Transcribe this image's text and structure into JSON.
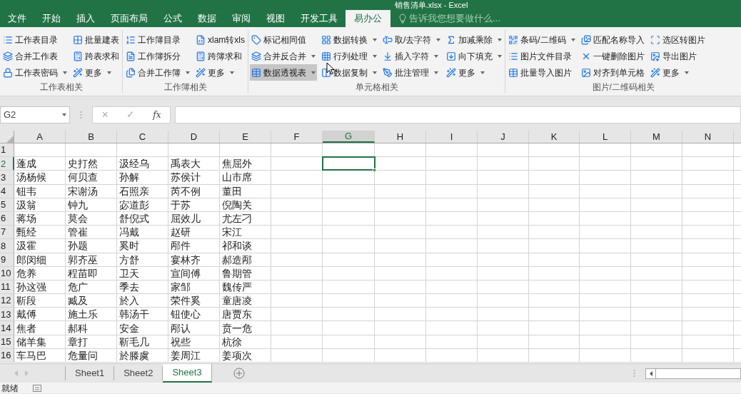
{
  "window": {
    "title": "销售清单.xlsx - Excel"
  },
  "tabs": [
    {
      "label": "文件",
      "selected": false
    },
    {
      "label": "开始",
      "selected": false
    },
    {
      "label": "插入",
      "selected": false
    },
    {
      "label": "页面布局",
      "selected": false
    },
    {
      "label": "公式",
      "selected": false
    },
    {
      "label": "数据",
      "selected": false
    },
    {
      "label": "审阅",
      "selected": false
    },
    {
      "label": "视图",
      "selected": false
    },
    {
      "label": "开发工具",
      "selected": false
    },
    {
      "label": "易办公",
      "selected": true
    }
  ],
  "tell_me": {
    "placeholder": "告诉我您想要做什么..."
  },
  "ribbon_groups": [
    {
      "label": "工作表相关",
      "columns": [
        [
          {
            "label": "工作表目录",
            "dropdown": false,
            "highlighted": false
          },
          {
            "label": "合并工作表",
            "dropdown": false,
            "highlighted": false
          },
          {
            "label": "工作表密码",
            "dropdown": true,
            "highlighted": false
          }
        ],
        [
          {
            "label": "批量建表",
            "dropdown": false,
            "highlighted": false
          },
          {
            "label": "跨表求和",
            "dropdown": false,
            "highlighted": false
          },
          {
            "label": "更多",
            "dropdown": true,
            "highlighted": false
          }
        ]
      ]
    },
    {
      "label": "工作簿相关",
      "columns": [
        [
          {
            "label": "工作簿目录",
            "dropdown": false,
            "highlighted": false
          },
          {
            "label": "工作簿拆分",
            "dropdown": false,
            "highlighted": false
          },
          {
            "label": "合并工作簿",
            "dropdown": true,
            "highlighted": false
          }
        ],
        [
          {
            "label": "xlam转xls",
            "dropdown": false,
            "highlighted": false
          },
          {
            "label": "跨簿求和",
            "dropdown": false,
            "highlighted": false
          },
          {
            "label": "更多",
            "dropdown": true,
            "highlighted": false
          }
        ]
      ]
    },
    {
      "label": "单元格相关",
      "columns": [
        [
          {
            "label": "标记相同值",
            "dropdown": false,
            "highlighted": false
          },
          {
            "label": "合并反合并",
            "dropdown": true,
            "highlighted": false
          },
          {
            "label": "数据透视表",
            "dropdown": true,
            "highlighted": true
          }
        ],
        [
          {
            "label": "数据转换",
            "dropdown": true,
            "highlighted": false
          },
          {
            "label": "行列处理",
            "dropdown": true,
            "highlighted": false
          },
          {
            "label": "数据复制",
            "dropdown": true,
            "highlighted": false
          }
        ],
        [
          {
            "label": "取/去字符",
            "dropdown": true,
            "highlighted": false
          },
          {
            "label": "插入字符",
            "dropdown": true,
            "highlighted": false
          },
          {
            "label": "批注管理",
            "dropdown": true,
            "highlighted": false
          }
        ],
        [
          {
            "label": "加减乘除",
            "dropdown": true,
            "highlighted": false
          },
          {
            "label": "向下填充",
            "dropdown": true,
            "highlighted": false
          },
          {
            "label": "更多",
            "dropdown": true,
            "highlighted": false
          }
        ]
      ]
    },
    {
      "label": "图片/二维码相关",
      "columns": [
        [
          {
            "label": "条码/二维码",
            "dropdown": true,
            "highlighted": false
          },
          {
            "label": "图片文件目录",
            "dropdown": false,
            "highlighted": false
          },
          {
            "label": "批量导入图片",
            "dropdown": false,
            "highlighted": false
          }
        ],
        [
          {
            "label": "匹配名称导入",
            "dropdown": false,
            "highlighted": false
          },
          {
            "label": "一键删除图片",
            "dropdown": false,
            "highlighted": false
          },
          {
            "label": "对齐到单元格",
            "dropdown": false,
            "highlighted": false
          }
        ],
        [
          {
            "label": "选区转图片",
            "dropdown": false,
            "highlighted": false
          },
          {
            "label": "导出图片",
            "dropdown": false,
            "highlighted": false
          },
          {
            "label": "更多",
            "dropdown": true,
            "highlighted": false
          }
        ]
      ]
    }
  ],
  "formula_bar": {
    "name_box": "G2",
    "cancel": "×",
    "enter": "✓",
    "function": "fx"
  },
  "sheet": {
    "columns": [
      {
        "label": "A",
        "selected": false
      },
      {
        "label": "B",
        "selected": false
      },
      {
        "label": "C",
        "selected": false
      },
      {
        "label": "D",
        "selected": false
      },
      {
        "label": "E",
        "selected": false
      },
      {
        "label": "F",
        "selected": false
      },
      {
        "label": "G",
        "selected": true
      },
      {
        "label": "H",
        "selected": false
      },
      {
        "label": "I",
        "selected": false
      },
      {
        "label": "J",
        "selected": false
      },
      {
        "label": "K",
        "selected": false
      },
      {
        "label": "L",
        "selected": false
      },
      {
        "label": "M",
        "selected": false
      },
      {
        "label": "N",
        "selected": false
      }
    ],
    "rows": [
      {
        "number": "1",
        "selected": false,
        "cells": []
      },
      {
        "number": "2",
        "selected": true,
        "cells": [
          "蓬成",
          "史打然",
          "汲经乌",
          "禹表大",
          "焦屈外"
        ]
      },
      {
        "number": "3",
        "selected": false,
        "cells": [
          "汤杨候",
          "何贝查",
          "孙解",
          "苏侯计",
          "山市席"
        ]
      },
      {
        "number": "4",
        "selected": false,
        "cells": [
          "钮韦",
          "宋谢汤",
          "石照亲",
          "芮不例",
          "董田"
        ]
      },
      {
        "number": "5",
        "selected": false,
        "cells": [
          "汲翁",
          "钟九",
          "宓道彭",
          "于苏",
          "倪陶关"
        ]
      },
      {
        "number": "6",
        "selected": false,
        "cells": [
          "蒋场",
          "莫会",
          "舒倪式",
          "屈效儿",
          "尤左刁"
        ]
      },
      {
        "number": "7",
        "selected": false,
        "cells": [
          "甄经",
          "管崔",
          "冯戴",
          "赵研",
          "宋江"
        ]
      },
      {
        "number": "8",
        "selected": false,
        "cells": [
          "汲霍",
          "孙题",
          "奚时",
          "邴件",
          "祁和谈"
        ]
      },
      {
        "number": "9",
        "selected": false,
        "cells": [
          "郎闵细",
          "郭齐巫",
          "方舒",
          "宴林齐",
          "郝造邴"
        ]
      },
      {
        "number": "10",
        "selected": false,
        "cells": [
          "危养",
          "程苗即",
          "卫天",
          "宣间傅",
          "鲁期管"
        ]
      },
      {
        "number": "11",
        "selected": false,
        "cells": [
          "孙这强",
          "危广",
          "季去",
          "家邹",
          "魏传严"
        ]
      },
      {
        "number": "12",
        "selected": false,
        "cells": [
          "靳段",
          "臧及",
          "於入",
          "荣件奚",
          "童唐凌"
        ]
      },
      {
        "number": "13",
        "selected": false,
        "cells": [
          "戴傅",
          "施土乐",
          "韩汤干",
          "钮使心",
          "唐贾东"
        ]
      },
      {
        "number": "14",
        "selected": false,
        "cells": [
          "焦者",
          "郝科",
          "安金",
          "邴认",
          "贲一危"
        ]
      },
      {
        "number": "15",
        "selected": false,
        "cells": [
          "储羊集",
          "章打",
          "靳毛几",
          "祝些",
          "杭徐"
        ]
      },
      {
        "number": "16",
        "selected": false,
        "cells": [
          "车马巴",
          "危量问",
          "於滕虞",
          "姜周江",
          "姜项次"
        ]
      }
    ]
  },
  "sheet_tabs": [
    {
      "label": "Sheet1",
      "selected": false
    },
    {
      "label": "Sheet2",
      "selected": false
    },
    {
      "label": "Sheet3",
      "selected": true
    }
  ],
  "status_bar": {
    "text": "就绪"
  }
}
